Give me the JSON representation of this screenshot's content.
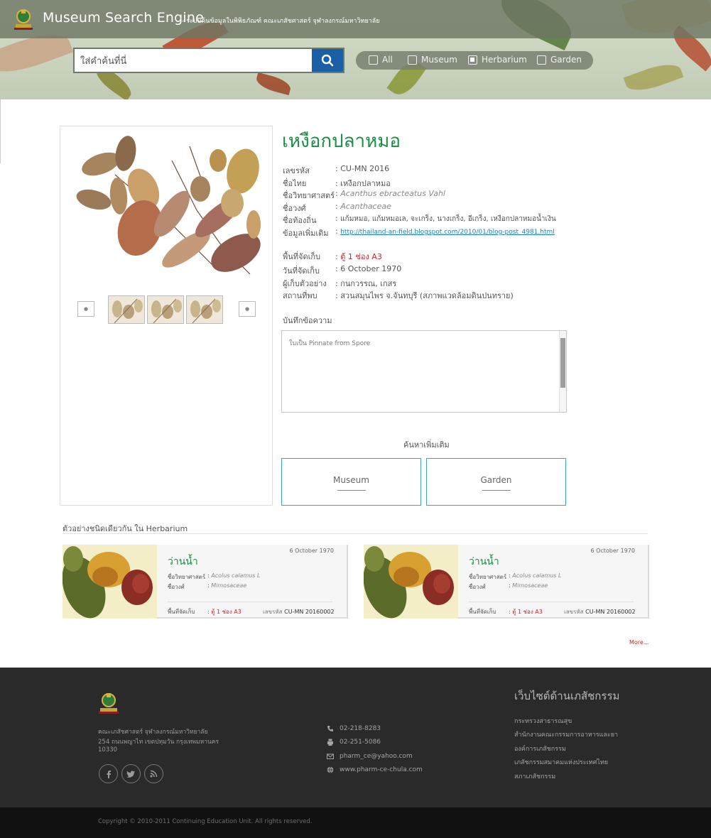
{
  "header": {
    "brand": "Museum Search Engine",
    "subtitle": "- ระบบค้นข้อมูลในพิพิธภัณฑ์ คณะเภสัชศาสตร์ จุฬาลงกรณ์มหาวิทยาลัย",
    "search_placeholder": "ใส่คำค้นที่นี่",
    "filters": [
      {
        "label": "All",
        "checked": false
      },
      {
        "label": "Museum",
        "checked": false
      },
      {
        "label": "Herbarium",
        "checked": true
      },
      {
        "label": "Garden",
        "checked": false
      }
    ]
  },
  "specimen": {
    "title": "เหงือกปลาหมอ",
    "fields": [
      {
        "label": "เลขรหัส",
        "value": "CU-MN 2016"
      },
      {
        "label": "ชื่อไทย",
        "value": "เหงือกปลาหมอ"
      },
      {
        "label": "ชื่อวิทยาศาสตร์",
        "value": "Acanthus ebracteatus Vahl"
      },
      {
        "label": "ชื่อวงศ์",
        "value": "Acanthaceae"
      },
      {
        "label": "ชื่อท้องถิ่น",
        "value": "แก้มหมอ, แก้มหมอเล, จะเกร็ง, นางเกร็ง, อีเกร็ง, เหงือกปลาหมอน้ำเงิน"
      },
      {
        "label": "ข้อมูลเพิ่มเติม",
        "value": "http://thailand-an-field.blogspot.com/2010/01/blog-post_4981.html"
      }
    ],
    "fields2": [
      {
        "label": "พื้นที่จัดเก็บ",
        "value": "ตู้ 1 ช่อง A3"
      },
      {
        "label": "วันที่จัดเก็บ",
        "value": "6 October 1970"
      },
      {
        "label": "ผู้เก็บตัวอย่าง",
        "value": "กนกวรรณ, เกสร"
      },
      {
        "label": "สถานที่พบ",
        "value": "สวนสมุนไพร จ.จันทบุรี (สภาพแวดล้อมดินปนทราย)"
      }
    ],
    "separator": ":",
    "note_label": "บันทึกข้อความ",
    "note_text": "ใบเป็น Pinnate from Spore",
    "more_search_label": "ค้นหาเพิ่มเติม",
    "more_buttons": [
      "Museum",
      "Garden"
    ]
  },
  "similar": {
    "title": "ตัวอย่างชนิดเดียวกัน ใน Herbarium",
    "cards": [
      {
        "date": "6 October  1970",
        "name": "ว่านน้ำ",
        "sci_label": "ชื่อวิทยาศาสตร์",
        "sci": "Acolus calamus L",
        "fam_label": "ชื่อวงศ์",
        "fam": "Mimosaceae",
        "loc_label": "พื้นที่จัดเก็บ",
        "loc": "ตู้ 1 ช่อง A3",
        "code_label": "เลขรหัส",
        "code": "CU-MN 20160002"
      },
      {
        "date": "6 October  1970",
        "name": "ว่านน้ำ",
        "sci_label": "ชื่อวิทยาศาสตร์",
        "sci": "Acolus calamus L",
        "fam_label": "ชื่อวงศ์",
        "fam": "Mimosaceae",
        "loc_label": "พื้นที่จัดเก็บ",
        "loc": "ตู้ 1 ช่อง A3",
        "code_label": "เลขรหัส",
        "code": "CU-MN 20160002"
      }
    ],
    "more": "More..."
  },
  "footer": {
    "address": [
      "คณะเภสัชศาสตร์ จุฬาลงกรณ์มหาวิทยาลัย",
      "254 ถนนพญาไท เขตปทุมวัน กรุงเทพมหานคร",
      "10330"
    ],
    "social_icons": [
      "facebook-icon",
      "twitter-icon",
      "rss-icon"
    ],
    "contacts": [
      {
        "icon": "phone-icon",
        "text": "02-218-8283"
      },
      {
        "icon": "fax-icon",
        "text": "02-251-5086"
      },
      {
        "icon": "mail-icon",
        "text": "pharm_ce@yahoo.com"
      },
      {
        "icon": "globe-icon",
        "text": "www.pharm-ce-chula.com"
      }
    ],
    "links_title": "เว็บไซต์ด้านเภสัชกรรม",
    "links": [
      "กระทรวงสาธารณสุข",
      "สำนักงานคณะกรรมการอาหารและยา",
      "องค์การเภสัชกรรม",
      "เภสัชกรรมสมาคมแห่งประเทศไทย",
      "สภาเภสัชกรรม"
    ],
    "copyright": "Copyright © 2010-2011 Continuing Education Unit. All rights reserved."
  },
  "colors": {
    "accent_green": "#1b8e45",
    "accent_blue": "#1a5fa6",
    "accent_red": "#d2232a",
    "footer_bg": "#2a2a2a"
  }
}
